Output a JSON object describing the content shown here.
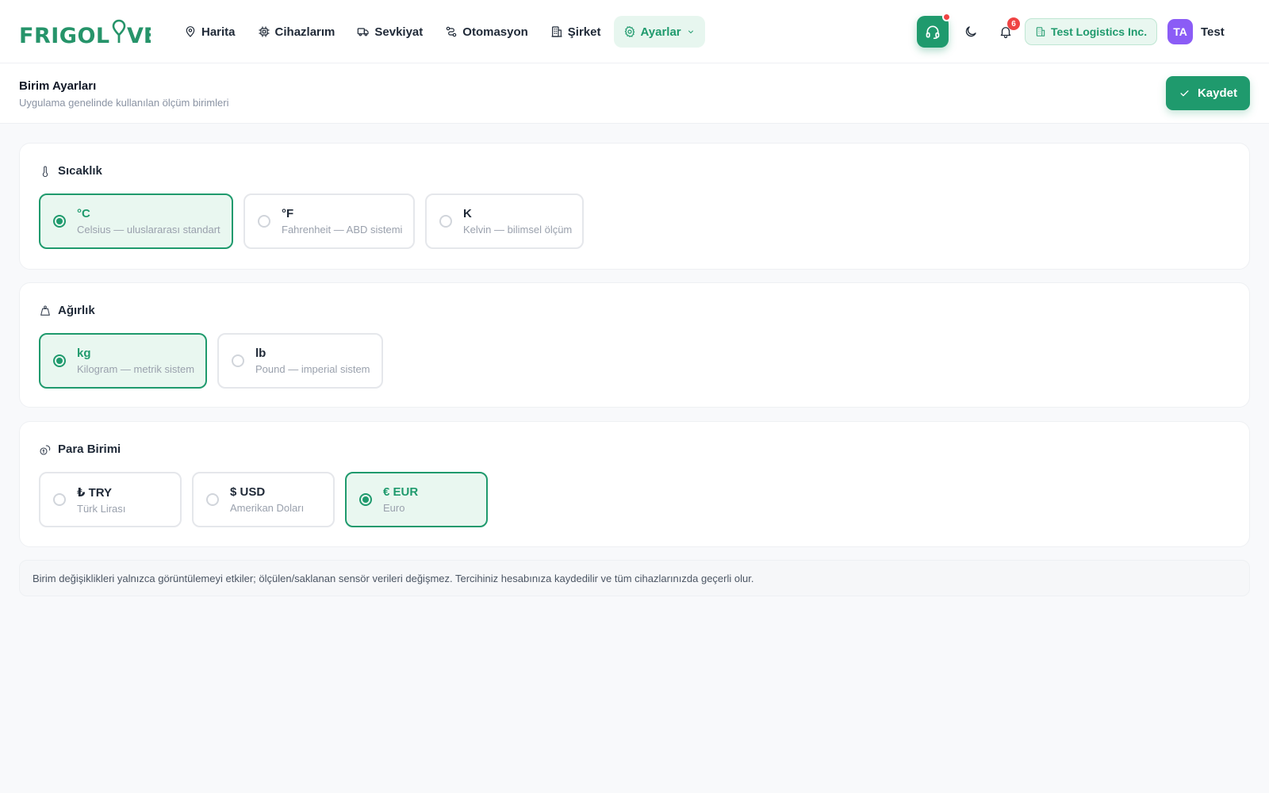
{
  "brand": {
    "name": "FRIGOLIVE",
    "color": "#26946a"
  },
  "nav": {
    "items": [
      {
        "label": "Harita",
        "icon": "map-pin-icon"
      },
      {
        "label": "Cihazlarım",
        "icon": "cpu-icon"
      },
      {
        "label": "Sevkiyat",
        "icon": "truck-icon"
      },
      {
        "label": "Otomasyon",
        "icon": "route-icon"
      },
      {
        "label": "Şirket",
        "icon": "building-icon"
      },
      {
        "label": "Ayarlar",
        "icon": "gear-icon",
        "active": true
      }
    ]
  },
  "toolbar": {
    "notification_count": "6",
    "company": "Test Logistics Inc.",
    "avatar_initials": "TA",
    "user_name": "Test"
  },
  "page": {
    "title": "Birim Ayarları",
    "subtitle": "Uygulama genelinde kullanılan ölçüm birimleri",
    "save_label": "Kaydet"
  },
  "sections": {
    "temperature": {
      "title": "Sıcaklık",
      "icon": "thermometer-icon",
      "options": [
        {
          "label": "°C",
          "desc": "Celsius — uluslararası standart",
          "selected": true
        },
        {
          "label": "°F",
          "desc": "Fahrenheit — ABD sistemi",
          "selected": false
        },
        {
          "label": "K",
          "desc": "Kelvin — bilimsel ölçüm",
          "selected": false
        }
      ]
    },
    "weight": {
      "title": "Ağırlık",
      "icon": "weight-icon",
      "options": [
        {
          "label": "kg",
          "desc": "Kilogram — metrik sistem",
          "selected": true
        },
        {
          "label": "lb",
          "desc": "Pound — imperial sistem",
          "selected": false
        }
      ]
    },
    "currency": {
      "title": "Para Birimi",
      "icon": "coins-icon",
      "options": [
        {
          "label": "₺ TRY",
          "desc": "Türk Lirası",
          "selected": false
        },
        {
          "label": "$ USD",
          "desc": "Amerikan Doları",
          "selected": false
        },
        {
          "label": "€ EUR",
          "desc": "Euro",
          "selected": true
        }
      ]
    }
  },
  "note": "Birim değişiklikleri yalnızca görüntülemeyi etkiler; ölçülen/saklanan sensör verileri değişmez. Tercihiniz hesabınıza kaydedilir ve tüm cihazlarınızda geçerli olur.",
  "colors": {
    "accent": "#1f9a6d",
    "accent_light": "#e9f7f0",
    "danger": "#ef4444",
    "avatar": "#8b5cf6"
  }
}
